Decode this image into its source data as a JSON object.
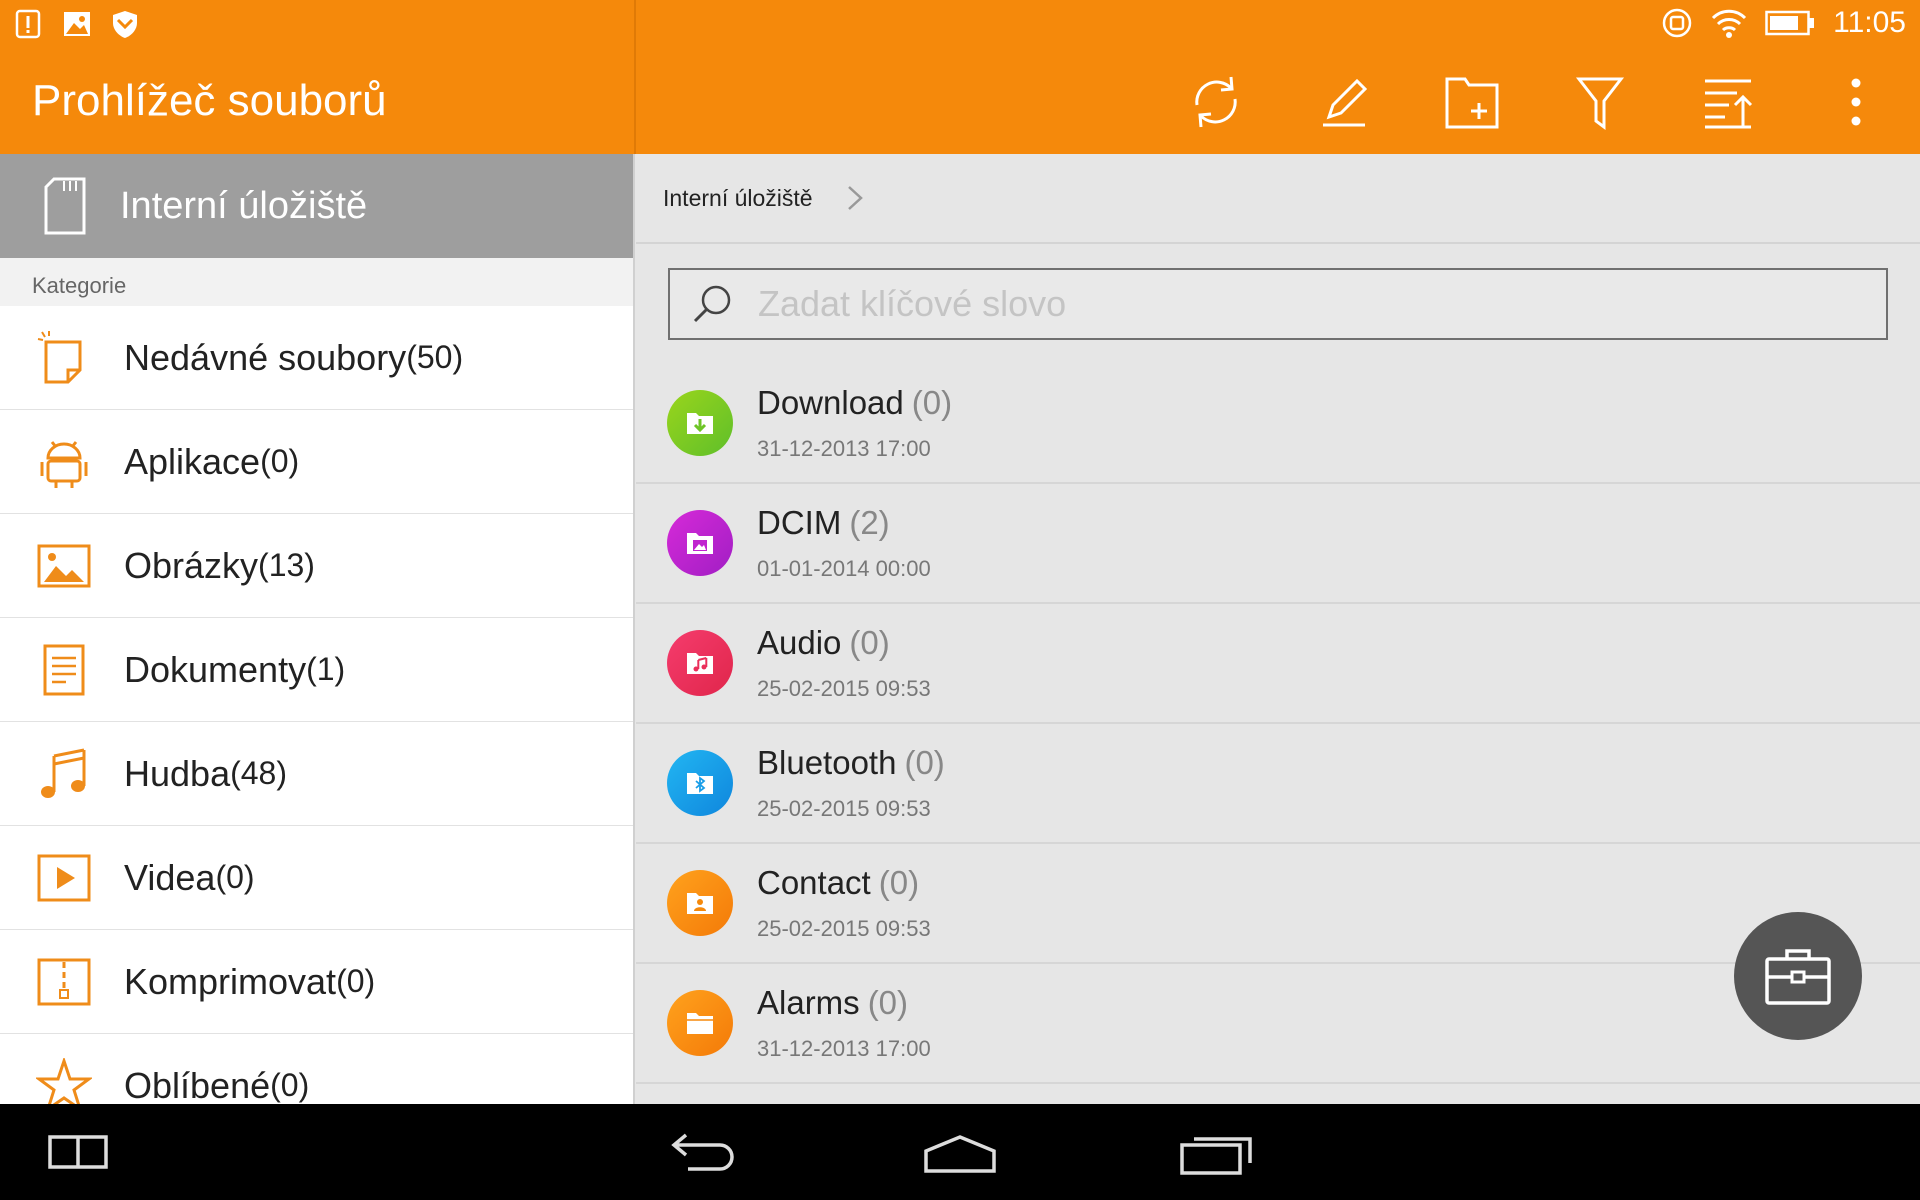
{
  "status_bar": {
    "time": "11:05",
    "left_icons": [
      "alert-icon",
      "image-icon",
      "shield-icon"
    ],
    "right_icons": [
      "location-icon",
      "wifi-icon",
      "battery-icon"
    ]
  },
  "header": {
    "title": "Prohlížeč souborů",
    "color": "#f5890b",
    "actions": [
      "refresh-icon",
      "edit-icon",
      "new-folder-icon",
      "filter-icon",
      "sort-icon",
      "more-icon"
    ]
  },
  "drawer": {
    "storage_label": "Interní úložiště",
    "section_title": "Kategorie",
    "categories": [
      {
        "label": "Nedávné soubory",
        "count": "(50)",
        "icon": "recent-files-icon"
      },
      {
        "label": "Aplikace",
        "count": "(0)",
        "icon": "android-icon"
      },
      {
        "label": "Obrázky",
        "count": "(13)",
        "icon": "image-icon"
      },
      {
        "label": "Dokumenty",
        "count": "(1)",
        "icon": "document-icon"
      },
      {
        "label": "Hudba",
        "count": "(48)",
        "icon": "music-icon"
      },
      {
        "label": "Videa",
        "count": "(0)",
        "icon": "video-icon"
      },
      {
        "label": "Komprimovat",
        "count": "(0)",
        "icon": "zip-icon"
      },
      {
        "label": "Oblíbené",
        "count": "(0)",
        "icon": "star-icon"
      }
    ]
  },
  "main": {
    "breadcrumb": "Interní úložiště",
    "search_placeholder": "Zadat klíčové slovo",
    "folders": [
      {
        "name": "Download",
        "count": "(0)",
        "date": "31-12-2013 17:00",
        "color_a": "#9ad51c",
        "color_b": "#5fbf2a",
        "icon": "download-folder-icon"
      },
      {
        "name": "DCIM",
        "count": "(2)",
        "date": "01-01-2014 00:00",
        "color_a": "#d62ad8",
        "color_b": "#a11ec4",
        "icon": "image-folder-icon"
      },
      {
        "name": "Audio",
        "count": "(0)",
        "date": "25-02-2015 09:53",
        "color_a": "#f53c6d",
        "color_b": "#e0264b",
        "icon": "music-folder-icon"
      },
      {
        "name": "Bluetooth",
        "count": "(0)",
        "date": "25-02-2015 09:53",
        "color_a": "#22b6f2",
        "color_b": "#0f86dd",
        "icon": "bluetooth-folder-icon"
      },
      {
        "name": "Contact",
        "count": "(0)",
        "date": "25-02-2015 09:53",
        "color_a": "#ffa21d",
        "color_b": "#f47a08",
        "icon": "contact-folder-icon"
      },
      {
        "name": "Alarms",
        "count": "(0)",
        "date": "31-12-2013 17:00",
        "color_a": "#ffa21d",
        "color_b": "#f47a08",
        "icon": "folder-icon"
      }
    ]
  },
  "fab": {
    "icon": "toolbox-icon"
  },
  "nav_bar": {
    "buttons": [
      "split-screen-icon",
      "back-icon",
      "home-icon",
      "recents-icon"
    ]
  }
}
